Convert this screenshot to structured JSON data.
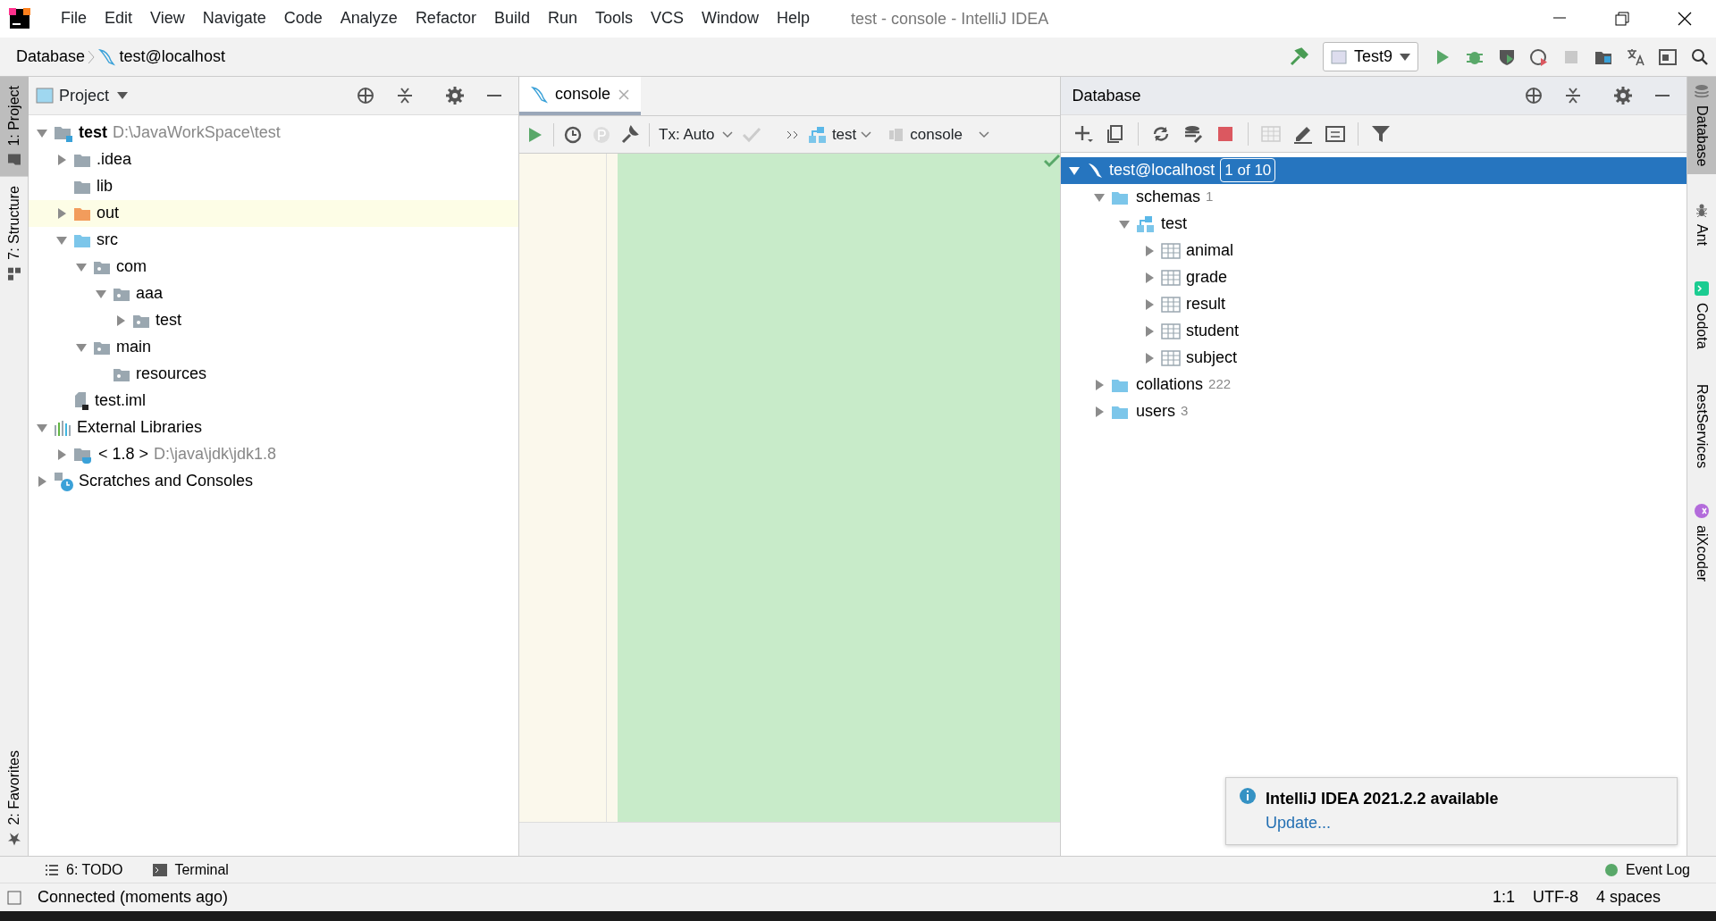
{
  "window": {
    "title": "test - console - IntelliJ IDEA"
  },
  "menu": [
    "File",
    "Edit",
    "View",
    "Navigate",
    "Code",
    "Analyze",
    "Refactor",
    "Build",
    "Run",
    "Tools",
    "VCS",
    "Window",
    "Help"
  ],
  "breadcrumbs": [
    "Database",
    "test@localhost"
  ],
  "run_config": "Test9",
  "left_stripe": [
    {
      "label": "1: Project",
      "selected": true
    },
    {
      "label": "7: Structure",
      "selected": false
    }
  ],
  "left_stripe_bottom": [
    {
      "label": "2: Favorites",
      "selected": false
    }
  ],
  "project_panel": {
    "title": "Project",
    "tree": [
      {
        "label": "test",
        "detail": "D:\\JavaWorkSpace\\test",
        "kind": "module",
        "expanded": true,
        "highlighted": false,
        "children": [
          {
            "label": ".idea",
            "kind": "folder",
            "expanded": false,
            "highlighted": false
          },
          {
            "label": "lib",
            "kind": "folder",
            "highlighted": false
          },
          {
            "label": "out",
            "kind": "excluded",
            "expanded": false,
            "highlighted": true
          },
          {
            "label": "src",
            "kind": "source",
            "expanded": true,
            "highlighted": false,
            "children": [
              {
                "label": "com",
                "kind": "package",
                "expanded": true,
                "highlighted": false,
                "children": [
                  {
                    "label": "aaa",
                    "kind": "package",
                    "expanded": true,
                    "highlighted": false,
                    "children": [
                      {
                        "label": "test",
                        "kind": "package",
                        "expanded": false,
                        "highlighted": false
                      }
                    ]
                  }
                ]
              },
              {
                "label": "main",
                "kind": "package",
                "expanded": true,
                "highlighted": false,
                "children": [
                  {
                    "label": "resources",
                    "kind": "package",
                    "highlighted": false
                  }
                ]
              }
            ]
          },
          {
            "label": "test.iml",
            "kind": "file",
            "highlighted": false
          }
        ]
      },
      {
        "label": "External Libraries",
        "kind": "libraries",
        "expanded": true,
        "highlighted": false,
        "children": [
          {
            "label": "< 1.8 >",
            "detail": "D:\\java\\jdk\\jdk1.8",
            "kind": "sdk",
            "expanded": false,
            "highlighted": false
          }
        ]
      },
      {
        "label": "Scratches and Consoles",
        "kind": "scratches",
        "expanded": false,
        "highlighted": false
      }
    ]
  },
  "editor": {
    "tabs": [
      {
        "label": "console",
        "selected": true
      }
    ],
    "tx_mode": "Tx: Auto",
    "schema": "test",
    "session": "console"
  },
  "database_panel": {
    "title": "Database",
    "tree": [
      {
        "label": "test@localhost",
        "badge": "1 of 10",
        "kind": "connection",
        "expanded": true,
        "selected": true,
        "children": [
          {
            "label": "schemas",
            "count": "1",
            "kind": "folder",
            "expanded": true,
            "selected": false,
            "children": [
              {
                "label": "test",
                "kind": "schema",
                "expanded": true,
                "selected": false,
                "children": [
                  {
                    "label": "animal",
                    "kind": "table",
                    "expanded": false,
                    "selected": false
                  },
                  {
                    "label": "grade",
                    "kind": "table",
                    "expanded": false,
                    "selected": false
                  },
                  {
                    "label": "result",
                    "kind": "table",
                    "expanded": false,
                    "selected": false
                  },
                  {
                    "label": "student",
                    "kind": "table",
                    "expanded": false,
                    "selected": false
                  },
                  {
                    "label": "subject",
                    "kind": "table",
                    "expanded": false,
                    "selected": false
                  }
                ]
              }
            ]
          },
          {
            "label": "collations",
            "count": "222",
            "kind": "folder",
            "expanded": false,
            "selected": false
          },
          {
            "label": "users",
            "count": "3",
            "kind": "folder",
            "expanded": false,
            "selected": false
          }
        ]
      }
    ]
  },
  "right_stripe": [
    {
      "label": "Database",
      "kind": "database",
      "selected": true
    },
    {
      "label": "Ant",
      "kind": "ant",
      "selected": false
    },
    {
      "label": "Codota",
      "kind": "codota",
      "selected": false
    },
    {
      "label": "RestServices",
      "kind": "none",
      "selected": false
    },
    {
      "label": "aiXcoder",
      "kind": "aixcoder",
      "selected": false
    }
  ],
  "notification": {
    "title": "IntelliJ IDEA 2021.2.2 available",
    "action": "Update..."
  },
  "bottom_tabs": [
    {
      "label": "6: TODO",
      "kind": "todo"
    },
    {
      "label": "Terminal",
      "kind": "terminal"
    }
  ],
  "bottom_right_tab": "Event Log",
  "status_bar": {
    "message": "Connected (moments ago)",
    "position": "1:1",
    "encoding": "UTF-8",
    "indent": "4 spaces"
  }
}
